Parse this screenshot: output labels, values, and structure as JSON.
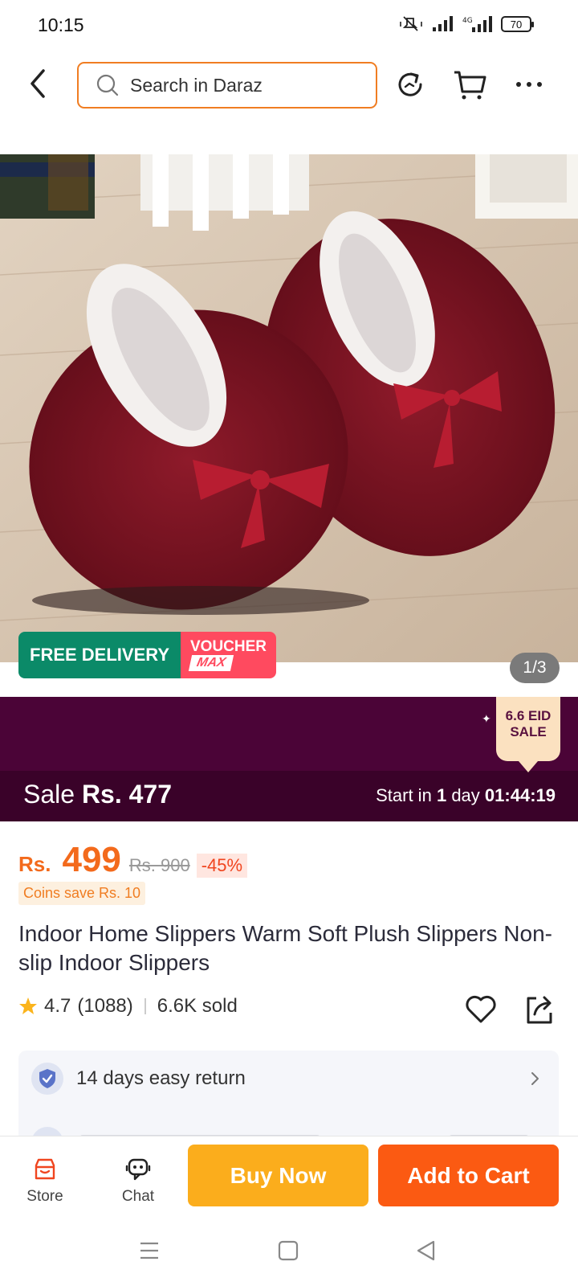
{
  "status_bar": {
    "time": "10:15",
    "network": "4G",
    "battery": "70"
  },
  "header": {
    "search_placeholder": "Search in Daraz"
  },
  "gallery": {
    "free_delivery": "FREE DELIVERY",
    "voucher": "VOUCHER",
    "voucher_max": "MAX",
    "counter": "1/3"
  },
  "campaign": {
    "badge_line1": "6.6 EID",
    "badge_line2": "SALE",
    "sale_prefix": "Sale",
    "sale_price": "Rs. 477",
    "start_prefix": "Start in",
    "start_days": "1",
    "start_day_word": "day",
    "start_time": "01:44:19"
  },
  "price": {
    "currency": "Rs.",
    "value": "499",
    "old": "Rs. 900",
    "discount": "-45%",
    "coins": "Coins save Rs. 10"
  },
  "product": {
    "title": "Indoor Home Slippers Warm Soft Plush Slippers Non-slip Indoor Slippers",
    "rating": "4.7",
    "reviews": "(1088)",
    "sold": "6.6K sold"
  },
  "services": {
    "return_text": "14 days easy return"
  },
  "bottom_bar": {
    "store": "Store",
    "chat": "Chat",
    "buy_now": "Buy Now",
    "add_to_cart": "Add to Cart"
  },
  "colors": {
    "brand_orange": "#f36a1c",
    "buy_now": "#fbad1c",
    "add_to_cart": "#fb5a12",
    "campaign_bg": "#4b0437",
    "free_delivery": "#0b8a68",
    "voucher": "#ff4a5f"
  }
}
